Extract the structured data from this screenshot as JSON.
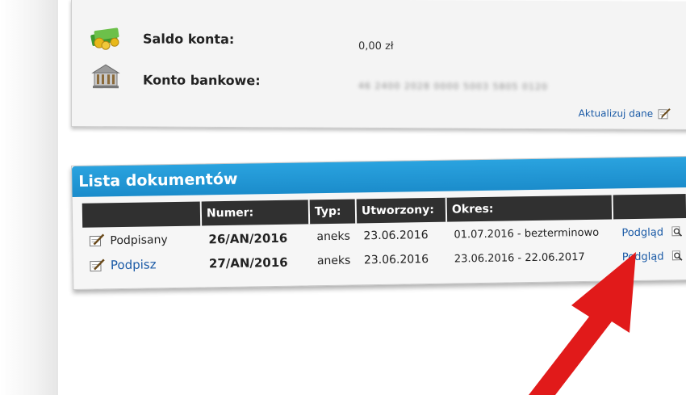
{
  "account": {
    "balance_label": "Saldo konta:",
    "balance_value": "0,00 zł",
    "bank_label": "Konto bankowe:",
    "bank_value": "46 2400 2028 0000 5003 5805 0120",
    "update_link": "Aktualizuj dane"
  },
  "documents": {
    "title": "Lista dokumentów",
    "columns": [
      "",
      "Numer:",
      "Typ:",
      "Utworzony:",
      "Okres:",
      ""
    ],
    "rows": [
      {
        "status": "Podpisany",
        "number": "26/AN/2016",
        "type": "aneks",
        "created": "23.06.2016",
        "period": "01.07.2016 - bezterminowo",
        "action": "Podgląd"
      },
      {
        "status": "Podpisz",
        "number": "27/AN/2016",
        "type": "aneks",
        "created": "23.06.2016",
        "period": "23.06.2016 - 22.06.2017",
        "action": "Podgląd"
      }
    ]
  },
  "icons": {
    "money": "money-stack-icon",
    "bank": "bank-building-icon",
    "edit": "edit-pencil-icon",
    "preview": "magnifier-icon"
  },
  "colors": {
    "header_blue": "#1b8ccb",
    "link_blue": "#1a5aa6",
    "table_header": "#303030",
    "arrow_red": "#e11a1a"
  }
}
